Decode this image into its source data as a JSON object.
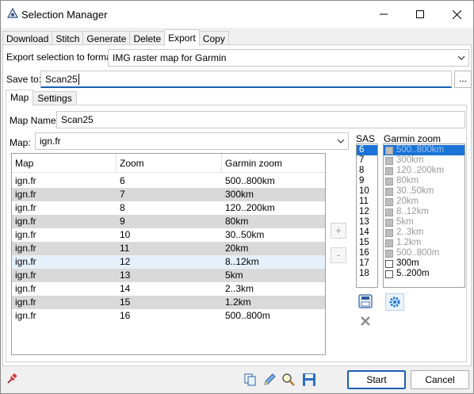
{
  "window": {
    "title": "Selection Manager",
    "app_icon": "app-icon"
  },
  "tabs": [
    "Download",
    "Stitch",
    "Generate",
    "Delete",
    "Export",
    "Copy"
  ],
  "active_tab": "Export",
  "export": {
    "format_label": "Export selection to format",
    "format_value": "IMG raster map for Garmin",
    "save_label": "Save to:",
    "save_value": "Scan25",
    "browse_label": "..."
  },
  "sub_tabs": [
    "Map",
    "Settings"
  ],
  "active_sub_tab": "Map",
  "map_name_label": "Map Name:",
  "map_name_value": "Scan25",
  "map_label": "Map:",
  "map_value": "ign.fr",
  "table": {
    "headers": [
      "Map",
      "Zoom",
      "Garmin zoom"
    ],
    "rows": [
      [
        "ign.fr",
        "6",
        "500..800km"
      ],
      [
        "ign.fr",
        "7",
        "300km"
      ],
      [
        "ign.fr",
        "8",
        "120..200km"
      ],
      [
        "ign.fr",
        "9",
        "80km"
      ],
      [
        "ign.fr",
        "10",
        "30..50km"
      ],
      [
        "ign.fr",
        "11",
        "20km"
      ],
      [
        "ign.fr",
        "12",
        "8..12km"
      ],
      [
        "ign.fr",
        "13",
        "5km"
      ],
      [
        "ign.fr",
        "14",
        "2..3km"
      ],
      [
        "ign.fr",
        "15",
        "1.2km"
      ],
      [
        "ign.fr",
        "16",
        "500..800m"
      ]
    ]
  },
  "add_label": "+",
  "remove_label": "-",
  "sas": {
    "label": "SAS",
    "items": [
      "6",
      "7",
      "8",
      "9",
      "10",
      "11",
      "12",
      "13",
      "14",
      "15",
      "16",
      "17",
      "18"
    ],
    "selected": "6"
  },
  "garmin_zoom": {
    "label": "Garmin zoom",
    "items": [
      "500..800km",
      "300km",
      "120..200km",
      "80km",
      "30..50km",
      "20km",
      "8..12km",
      "5km",
      "2..3km",
      "1.2km",
      "500..800m",
      "300m",
      "5..200m"
    ]
  },
  "buttons": {
    "start": "Start",
    "cancel": "Cancel"
  },
  "colors": {
    "selection": "#1a73d6",
    "accent": "#1a5fb4",
    "row_alt": "#d9d9d9",
    "row_hover": "#e5f0fb"
  }
}
